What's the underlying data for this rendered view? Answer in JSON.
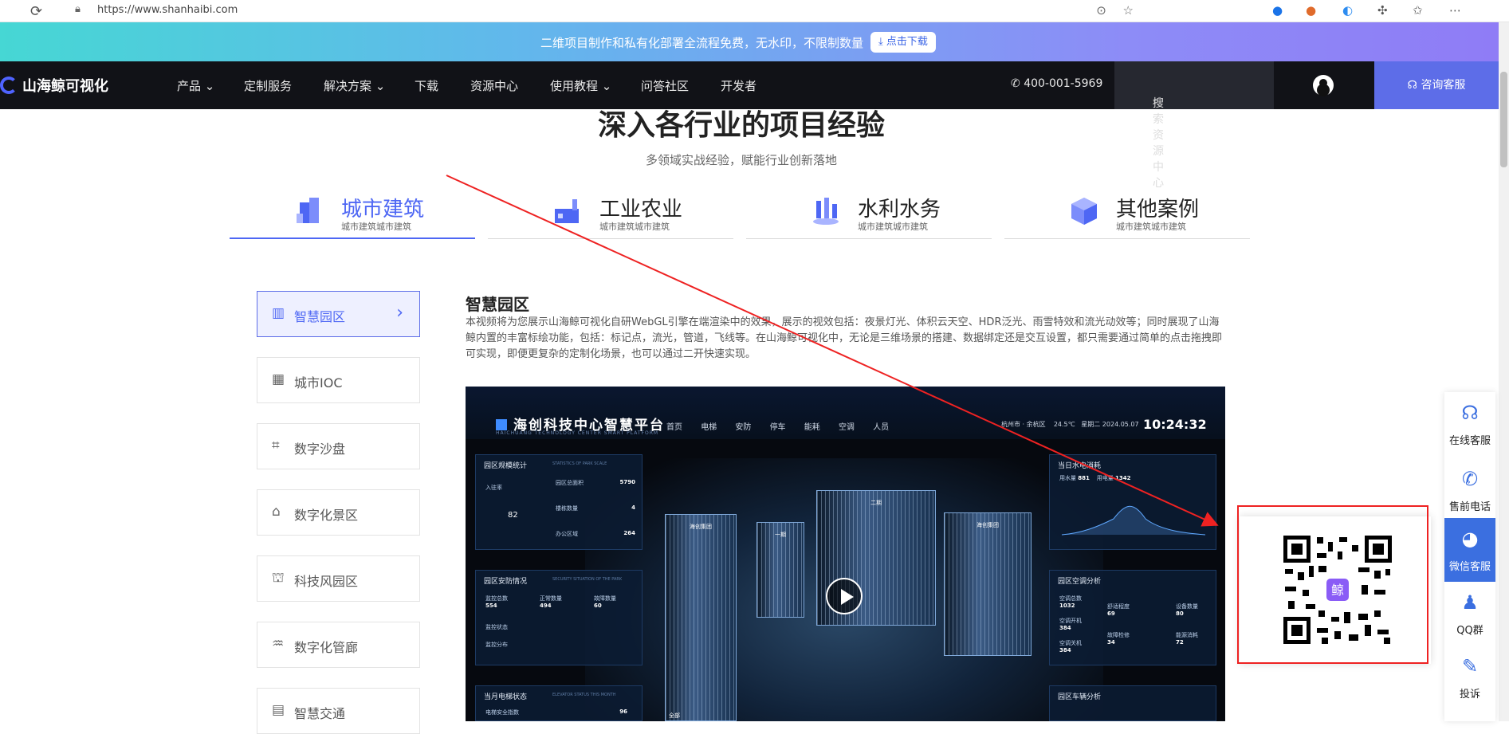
{
  "browser": {
    "url": "https://www.shanhaibi.com"
  },
  "announcement": {
    "message": "二维项目制作和私有化部署全流程免费，无水印，不限制数量",
    "download_label": "点击下载"
  },
  "nav": {
    "logo_text": "山海鲸可视化",
    "items": [
      {
        "label": "产品",
        "dropdown": true
      },
      {
        "label": "定制服务",
        "dropdown": false
      },
      {
        "label": "解决方案",
        "dropdown": true
      },
      {
        "label": "下载",
        "dropdown": false
      },
      {
        "label": "资源中心",
        "dropdown": false
      },
      {
        "label": "使用教程",
        "dropdown": true
      },
      {
        "label": "问答社区",
        "dropdown": false
      },
      {
        "label": "开发者",
        "dropdown": false
      }
    ],
    "phone": "400-001-5969",
    "search_placeholder": "搜索资源中心",
    "consult_label": "咨询客服"
  },
  "section": {
    "title": "深入各行业的项目经验",
    "subtitle": "多领域实战经验，赋能行业创新落地"
  },
  "categories": [
    {
      "name": "城市建筑",
      "small": "城市建筑城市建筑",
      "active": true
    },
    {
      "name": "工业农业",
      "small": "城市建筑城市建筑",
      "active": false
    },
    {
      "name": "水利水务",
      "small": "城市建筑城市建筑",
      "active": false
    },
    {
      "name": "其他案例",
      "small": "城市建筑城市建筑",
      "active": false
    }
  ],
  "sidebar": {
    "items": [
      {
        "label": "智慧园区",
        "icon": "building-icon",
        "active": true
      },
      {
        "label": "城市IOC",
        "icon": "city-icon",
        "active": false
      },
      {
        "label": "数字沙盘",
        "icon": "sandbox-icon",
        "active": false
      },
      {
        "label": "数字化景区",
        "icon": "scenic-icon",
        "active": false
      },
      {
        "label": "科技风园区",
        "icon": "tech-park-icon",
        "active": false
      },
      {
        "label": "数字化管廊",
        "icon": "pipe-gallery-icon",
        "active": false
      },
      {
        "label": "智慧交通",
        "icon": "traffic-icon",
        "active": false
      }
    ]
  },
  "detail": {
    "title": "智慧园区",
    "description": "本视频将为您展示山海鲸可视化自研WebGL引擎在端渲染中的效果，展示的视效包括：夜景灯光、体积云天空、HDR泛光、雨雪特效和流光动效等；同时展现了山海鲸内置的丰富标绘功能，包括：标记点，流光，管道，飞线等。在山海鲸可视化中，无论是三维场景的搭建、数据绑定还是交互设置，都只需要通过简单的点击拖拽即可实现，即便更复杂的定制化场景，也可以通过二开快速实现。"
  },
  "video": {
    "title": "海创科技中心智慧平台",
    "subtitle": "HAICHUANG TECHNOLOGY CENTER SMART PLATFORM",
    "tabs": [
      "首页",
      "电梯",
      "安防",
      "停车",
      "能耗",
      "空调",
      "人员"
    ],
    "location": "杭州市 · 余杭区",
    "temperature": "24.5℃",
    "weekday": "星期二",
    "date": "2024.05.07",
    "time": "10:24:32",
    "panels": {
      "park_stats": {
        "title": "园区规模统计",
        "sub": "STATISTICS OF PARK SCALE",
        "enter": "入驻率",
        "rate": "82",
        "rows": [
          {
            "label": "园区总面积",
            "value": "5790"
          },
          {
            "label": "楼栋数量",
            "value": "4"
          },
          {
            "label": "办公区域",
            "value": "264"
          }
        ]
      },
      "security": {
        "title": "园区安防情况",
        "sub": "SECURITY SITUATION OF THE PARK",
        "cols": [
          {
            "label": "监控总数",
            "value": "554"
          },
          {
            "label": "正常数量",
            "value": "494"
          },
          {
            "label": "故障数量",
            "value": "60"
          }
        ],
        "rows": [
          "监控状态",
          "监控分布"
        ]
      },
      "elevator": {
        "title": "当月电梯状态",
        "sub": "ELEVATOR STATUS THIS MONTH",
        "row": "电梯安全指数",
        "value": "96"
      },
      "energy": {
        "title": "当日水电消耗",
        "sub": "WATER AND POWER CONSUMPTION THIS MONTH",
        "water_label": "用水量",
        "water": "881",
        "power_label": "用电量",
        "power": "1342",
        "axis": [
          "06:00",
          "08:00",
          "10:00",
          "12:00",
          "14:00",
          "16:00",
          "18:00"
        ],
        "left_ticks": [
          "300",
          "225",
          "150",
          "75",
          "0"
        ],
        "right_ticks": [
          "300",
          "240",
          "180",
          "120",
          "60",
          "0"
        ]
      },
      "aircon": {
        "title": "园区空调分析",
        "sub": "ANALYSIS OF AIR CONDITIONING IN THE PARK",
        "rows": [
          {
            "label": "空调总数",
            "value": "1032"
          },
          {
            "label": "空调开机",
            "value": "384"
          },
          {
            "label": "空调关机",
            "value": "384"
          },
          {
            "label": "故障检修",
            "value": "34"
          },
          {
            "label": "舒适程度",
            "value": "69"
          },
          {
            "label": "设备数量",
            "value": "80"
          },
          {
            "label": "能源消耗",
            "value": "72"
          }
        ]
      },
      "vehicles": {
        "title": "园区车辆分析",
        "sub": "ANALYSIS OF PARK VEHICLES"
      },
      "buildings": [
        "海创集团",
        "一期",
        "二期",
        "海创集团"
      ]
    },
    "bottom_label": "全部"
  },
  "float_menu": {
    "items": [
      {
        "label": "在线客服",
        "icon": "headset-icon",
        "active": false
      },
      {
        "label": "售前电话",
        "icon": "phone-icon",
        "active": false
      },
      {
        "label": "微信客服",
        "icon": "wechat-icon",
        "active": true
      },
      {
        "label": "QQ群",
        "icon": "qq-icon",
        "active": false
      },
      {
        "label": "投诉",
        "icon": "complaint-icon",
        "active": false
      }
    ],
    "qr_logo": "鲸"
  },
  "colors": {
    "accent": "#4e67f4",
    "nav_bg": "#111217",
    "annotation_red": "#e22222"
  }
}
